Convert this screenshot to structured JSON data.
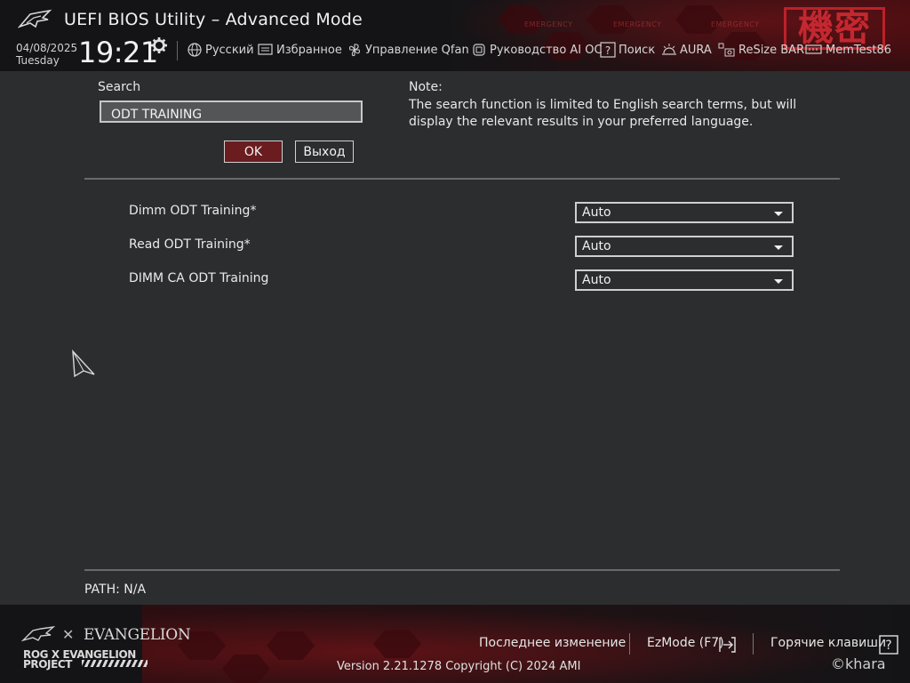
{
  "header": {
    "title": "UEFI BIOS Utility – Advanced Mode",
    "date": "04/08/2025",
    "weekday": "Tuesday",
    "time": "19:21",
    "kanji": "機密",
    "hex_labels": [
      "EMERGENCY",
      "EMERGENCY",
      "EMERGENCY"
    ],
    "nav": [
      {
        "label": "Русский",
        "icon": "globe-icon"
      },
      {
        "label": "Избранное",
        "icon": "favorites-icon"
      },
      {
        "label": "Управление Qfan",
        "icon": "fan-icon"
      },
      {
        "label": "Руководство AI OC",
        "icon": "ai-chip-icon"
      },
      {
        "label": "Поиск",
        "icon": "question-icon"
      },
      {
        "label": "AURA",
        "icon": "aura-icon"
      },
      {
        "label": "ReSize BAR",
        "icon": "resize-bar-icon"
      },
      {
        "label": "MemTest86",
        "icon": "memory-icon"
      }
    ]
  },
  "search": {
    "label": "Search",
    "value": "ODT TRAINING",
    "ok_label": "OK",
    "exit_label": "Выход"
  },
  "note": {
    "title": "Note:",
    "text": "The search function is limited to English search terms, but will display the relevant results in your preferred language."
  },
  "results": [
    {
      "label": "Dimm ODT Training*",
      "value": "Auto"
    },
    {
      "label": "Read ODT Training*",
      "value": "Auto"
    },
    {
      "label": "DIMM CA ODT Training",
      "value": "Auto"
    }
  ],
  "path": "PATH: N/A",
  "footer": {
    "evangelion": "EVANGELION",
    "project_line1": "ROG X EVANGELION",
    "project_line2": "PROJECT",
    "last_change": "Последнее изменение",
    "ezmode": "EzMode (F7)",
    "hotkeys": "Горячие клавиши",
    "version": "Version 2.21.1278 Copyright (C) 2024 AMI",
    "khara": "©khara"
  },
  "colors": {
    "accent_red": "#c8232c",
    "ok_button": "#6a1c1f",
    "background": "#2c2d2f",
    "header_bg": "#141416"
  }
}
